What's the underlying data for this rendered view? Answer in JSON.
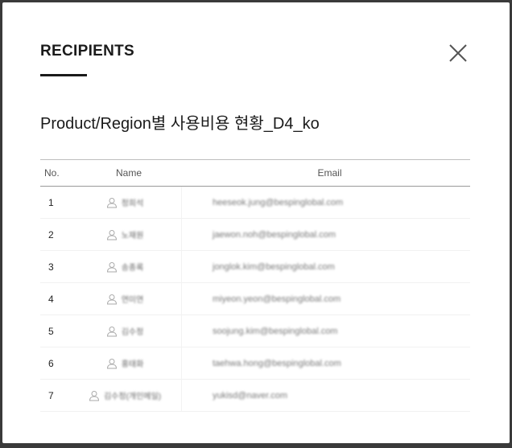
{
  "modal": {
    "title": "RECIPIENTS",
    "subtitle": "Product/Region별 사용비용 현황_D4_ko",
    "close_icon": "close-icon"
  },
  "table": {
    "headers": {
      "no": "No.",
      "name": "Name",
      "email": "Email"
    },
    "rows": [
      {
        "no": "1",
        "name": "정희석",
        "email": "heeseok.jung@bespinglobal.com"
      },
      {
        "no": "2",
        "name": "노재원",
        "email": "jaewon.noh@bespinglobal.com"
      },
      {
        "no": "3",
        "name": "송종록",
        "email": "jonglok.kim@bespinglobal.com"
      },
      {
        "no": "4",
        "name": "연미연",
        "email": "miyeon.yeon@bespinglobal.com"
      },
      {
        "no": "5",
        "name": "김수정",
        "email": "soojung.kim@bespinglobal.com"
      },
      {
        "no": "6",
        "name": "홍태화",
        "email": "taehwa.hong@bespinglobal.com"
      },
      {
        "no": "7",
        "name": "김수정(개인메일)",
        "email": "yukisd@naver.com"
      }
    ]
  },
  "colors": {
    "text": "#1a1a1a",
    "muted": "#888888",
    "overlay": "#3a3a3a"
  }
}
